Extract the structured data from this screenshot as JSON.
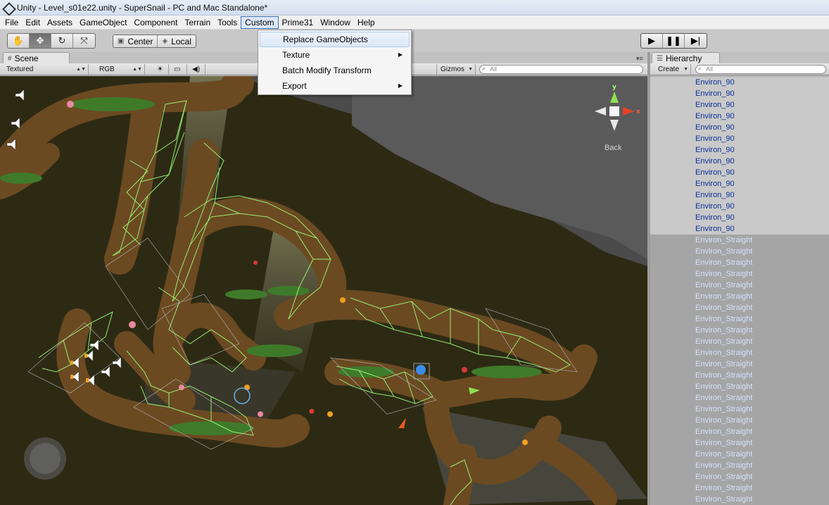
{
  "window": {
    "title": "Unity - Level_s01e22.unity - SuperSnail - PC and Mac Standalone*"
  },
  "menubar": {
    "items": [
      "File",
      "Edit",
      "Assets",
      "GameObject",
      "Component",
      "Terrain",
      "Tools",
      "Custom",
      "Prime31",
      "Window",
      "Help"
    ],
    "active": "Custom"
  },
  "custom_menu": {
    "items": [
      {
        "label": "Replace GameObjects",
        "submenu": false,
        "highlighted": true
      },
      {
        "label": "Texture",
        "submenu": true,
        "highlighted": false
      },
      {
        "label": "Batch Modify Transform",
        "submenu": false,
        "highlighted": false
      },
      {
        "label": "Export",
        "submenu": true,
        "highlighted": false
      }
    ]
  },
  "toolbar": {
    "transform_tools": [
      "hand-icon",
      "move-icon",
      "rotate-icon",
      "scale-icon"
    ],
    "selected_tool": "move-icon",
    "pivot_label": "Center",
    "space_label": "Local",
    "play_controls": [
      "play-icon",
      "pause-icon",
      "step-icon"
    ]
  },
  "scene": {
    "tab_label": "Scene",
    "render_mode": "Textured",
    "color_mode": "RGB",
    "gizmos_label": "Gizmos",
    "search_placeholder": "All",
    "view_label": "Back",
    "axis_y": "y",
    "axis_x": "x"
  },
  "hierarchy": {
    "tab_label": "Hierarchy",
    "create_label": "Create",
    "search_placeholder": "All",
    "selected_items": [
      "Environ_90",
      "Environ_90",
      "Environ_90",
      "Environ_90",
      "Environ_90",
      "Environ_90",
      "Environ_90",
      "Environ_90",
      "Environ_90",
      "Environ_90",
      "Environ_90",
      "Environ_90",
      "Environ_90",
      "Environ_90"
    ],
    "other_items": [
      "Environ_Straight",
      "Environ_Straight",
      "Environ_Straight",
      "Environ_Straight",
      "Environ_Straight",
      "Environ_Straight",
      "Environ_Straight",
      "Environ_Straight",
      "Environ_Straight",
      "Environ_Straight",
      "Environ_Straight",
      "Environ_Straight",
      "Environ_Straight",
      "Environ_Straight",
      "Environ_Straight",
      "Environ_Straight",
      "Environ_Straight",
      "Environ_Straight",
      "Environ_Straight",
      "Environ_Straight",
      "Environ_Straight",
      "Environ_Straight",
      "Environ_Straight",
      "Environ_Straight"
    ]
  },
  "colors": {
    "wireframe": "#9dff7a",
    "dirt": "#6b4a22",
    "cave": "#2a2612",
    "selection_text": "#0b2f9a"
  }
}
